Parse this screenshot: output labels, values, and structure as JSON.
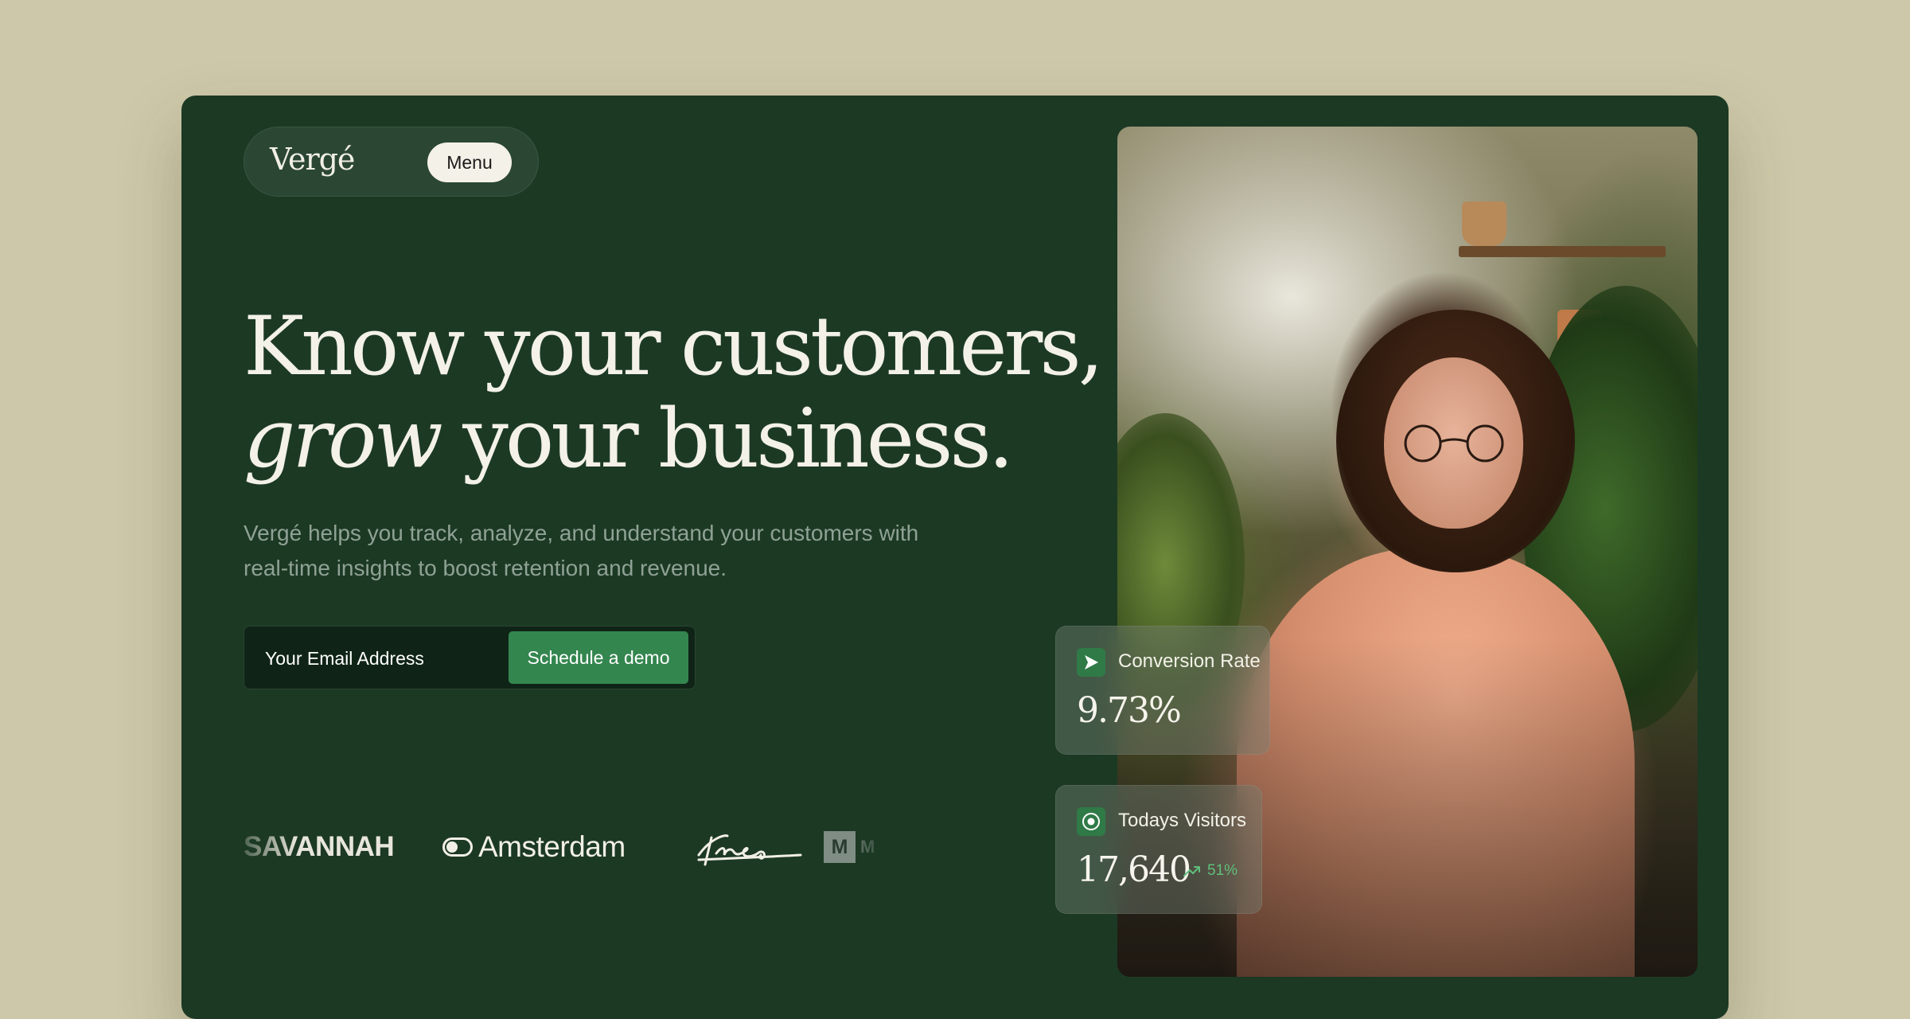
{
  "brand": {
    "name": "Vergé"
  },
  "nav": {
    "menu_label": "Menu"
  },
  "hero": {
    "headline_line1": "Know your customers,",
    "headline_italic": "grow",
    "headline_line2_rest": " your business.",
    "subtext": "Vergé helps you track, analyze, and understand your customers with real-time insights to boost retention and revenue."
  },
  "form": {
    "email_placeholder": "Your Email Address",
    "cta_label": "Schedule a demo"
  },
  "logos": {
    "savannah": "SAVANNAH",
    "amsterdam": "Amsterdam",
    "theo": "theo",
    "m_mark": "M",
    "m_text": "M"
  },
  "stats": {
    "conversion": {
      "label": "Conversion Rate",
      "value": "9.73%"
    },
    "visitors": {
      "label": "Todays Visitors",
      "value": "17,640",
      "trend": "51%"
    }
  },
  "colors": {
    "page_bg": "#cdc8a9",
    "card_bg": "#1c3924",
    "accent": "#34864f",
    "trend_up": "#5fbf7b"
  },
  "icons": {
    "menu": "toggle-icon",
    "conversion": "send-arrow-icon",
    "visitors": "chrome-circle-icon",
    "trend": "trend-up-icon"
  }
}
